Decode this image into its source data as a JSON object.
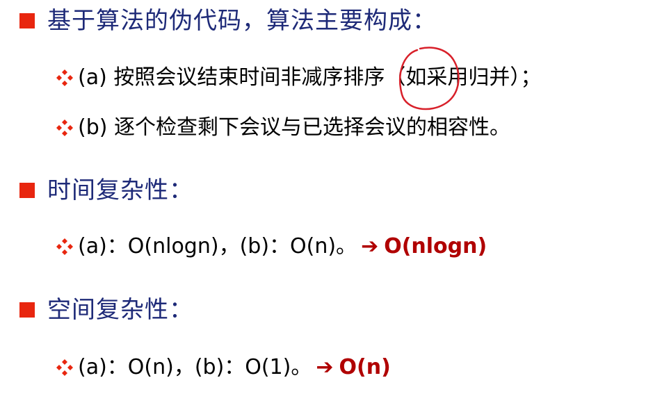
{
  "headings": [
    {
      "text": "基于算法的伪代码，算法主要构成："
    },
    {
      "text": "时间复杂性："
    },
    {
      "text": "空间复杂性："
    }
  ],
  "bullets": {
    "a": {
      "label": "(a) 按照会议结束时间非减序排序（如采用归并）；"
    },
    "b": {
      "label": "(b) 逐个检查剩下会议与已选择会议的相容性。"
    },
    "time": {
      "label": "(a)：O(nlogn)，(b)：O(n)。",
      "arrow": "➔",
      "result": "O(nlogn)"
    },
    "space": {
      "label": "(a)：O(n)，(b)：O(1)。",
      "arrow": "➔",
      "result": "O(n)"
    }
  },
  "colors": {
    "heading": "#1e2a78",
    "square": "#e8260f",
    "diamond": "#e8260f",
    "result": "#b00000",
    "annotation": "#d8202a"
  },
  "icons": {
    "square": "red-square-bullet-icon",
    "diamond": "four-diamond-bullet-icon",
    "arrow": "right-arrow-icon"
  }
}
